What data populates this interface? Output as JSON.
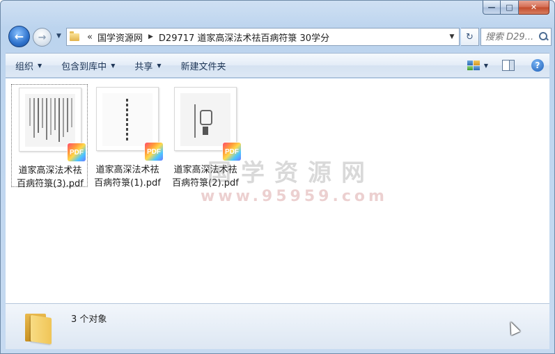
{
  "window": {
    "caption": {
      "minimize": "—",
      "maximize": "□",
      "close": "✕"
    }
  },
  "nav": {
    "back_glyph": "←",
    "forward_glyph": "→",
    "recent_glyph": "▼",
    "breadcrumb_overflow": "«",
    "breadcrumb": [
      "国学资源网",
      "D29717 道家高深法术祛百病符箓 30学分"
    ],
    "crumb_arrow": "▶",
    "address_dropdown": "▼",
    "refresh_glyph": "↻",
    "search_placeholder": "搜索 D29..."
  },
  "toolbar": {
    "organize": "组织",
    "include_in_library": "包含到库中",
    "share": "共享",
    "new_folder": "新建文件夹",
    "caret": "▼",
    "help": "?"
  },
  "files": [
    {
      "line1": "道家高深法术祛",
      "line2": "百病符箓(3).pdf",
      "badge": "PDF",
      "thumb": "text-columns",
      "selected": true
    },
    {
      "line1": "道家高深法术祛",
      "line2": "百病符箓(1).pdf",
      "badge": "PDF",
      "thumb": "title-page",
      "selected": false
    },
    {
      "line1": "道家高深法术祛",
      "line2": "百病符箓(2).pdf",
      "badge": "PDF",
      "thumb": "drawing",
      "selected": false
    }
  ],
  "watermark": {
    "main": "国学资源网",
    "sub": "www.95959.com"
  },
  "status": {
    "count_text": "3 个对象"
  },
  "colors": {
    "chrome": "#bcd4ee",
    "toolbar_text": "#1e3657",
    "close_red": "#c24a2c"
  }
}
